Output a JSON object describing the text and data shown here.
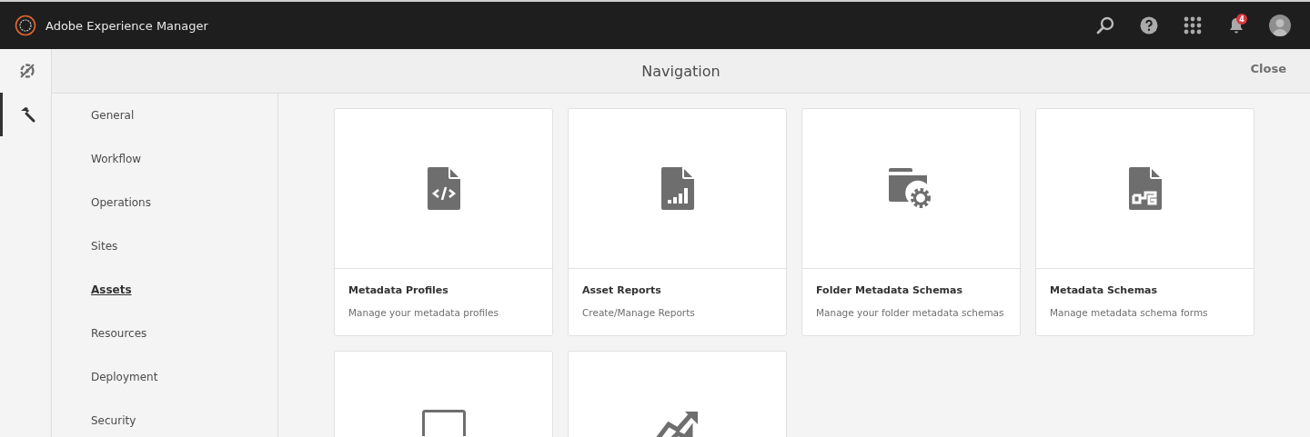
{
  "app_bar": {
    "title": "Adobe Experience Manager",
    "notification_count": "4"
  },
  "rail": [
    {
      "kind": "navigation",
      "selected": false
    },
    {
      "kind": "tools",
      "selected": true
    }
  ],
  "header": {
    "title": "Navigation",
    "close": "Close"
  },
  "categories": [
    {
      "label": "General",
      "selected": false
    },
    {
      "label": "Workflow",
      "selected": false
    },
    {
      "label": "Operations",
      "selected": false
    },
    {
      "label": "Sites",
      "selected": false
    },
    {
      "label": "Assets",
      "selected": true
    },
    {
      "label": "Resources",
      "selected": false
    },
    {
      "label": "Deployment",
      "selected": false
    },
    {
      "label": "Security",
      "selected": false
    }
  ],
  "cards": [
    {
      "kind": "code-file",
      "title": "Metadata Profiles",
      "description": "Manage your metadata profiles"
    },
    {
      "kind": "chart-file",
      "title": "Asset Reports",
      "description": "Create/Manage Reports"
    },
    {
      "kind": "folder-gear",
      "title": "Folder Metadata Schemas",
      "description": "Manage your folder metadata schemas"
    },
    {
      "kind": "schema-file",
      "title": "Metadata Schemas",
      "description": "Manage metadata schema forms"
    },
    {
      "kind": "monitor"
    },
    {
      "kind": "trend"
    }
  ]
}
